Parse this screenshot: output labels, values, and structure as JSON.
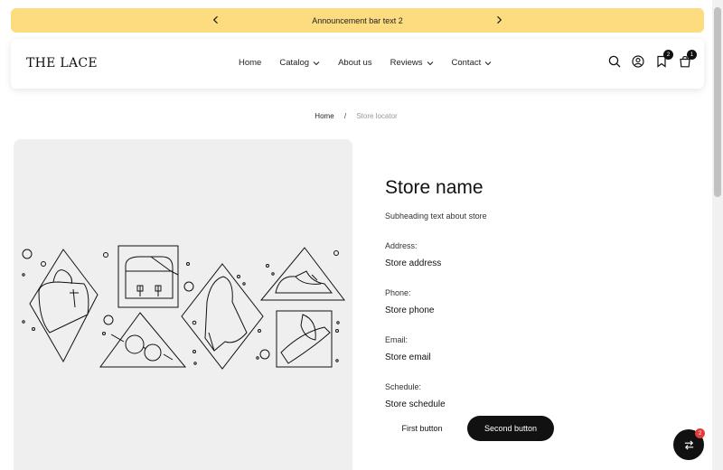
{
  "announcement": {
    "text": "Announcement bar text 2"
  },
  "header": {
    "logo": "THE LACE",
    "nav": [
      {
        "label": "Home",
        "dropdown": false
      },
      {
        "label": "Catalog",
        "dropdown": true
      },
      {
        "label": "About us",
        "dropdown": false
      },
      {
        "label": "Reviews",
        "dropdown": true
      },
      {
        "label": "Contact",
        "dropdown": true
      }
    ],
    "wishlist_count": "2",
    "cart_count": "1"
  },
  "breadcrumb": {
    "home": "Home",
    "separator": "/",
    "current": "Store locator"
  },
  "store": {
    "title": "Store name",
    "subheading": "Subheading text about store",
    "address_label": "Address:",
    "address_value": "Store address",
    "phone_label": "Phone:",
    "phone_value": "Store phone",
    "email_label": "Email:",
    "email_value": "Store email",
    "schedule_label": "Schedule:",
    "schedule_value": "Store schedule"
  },
  "buttons": {
    "first": "First button",
    "second": "Second button"
  },
  "fab": {
    "badge": "2"
  },
  "colors": {
    "announcement_bg": "#fddc7f",
    "dark": "#111111",
    "image_bg": "#efefef",
    "badge_red": "#e23b3b"
  }
}
